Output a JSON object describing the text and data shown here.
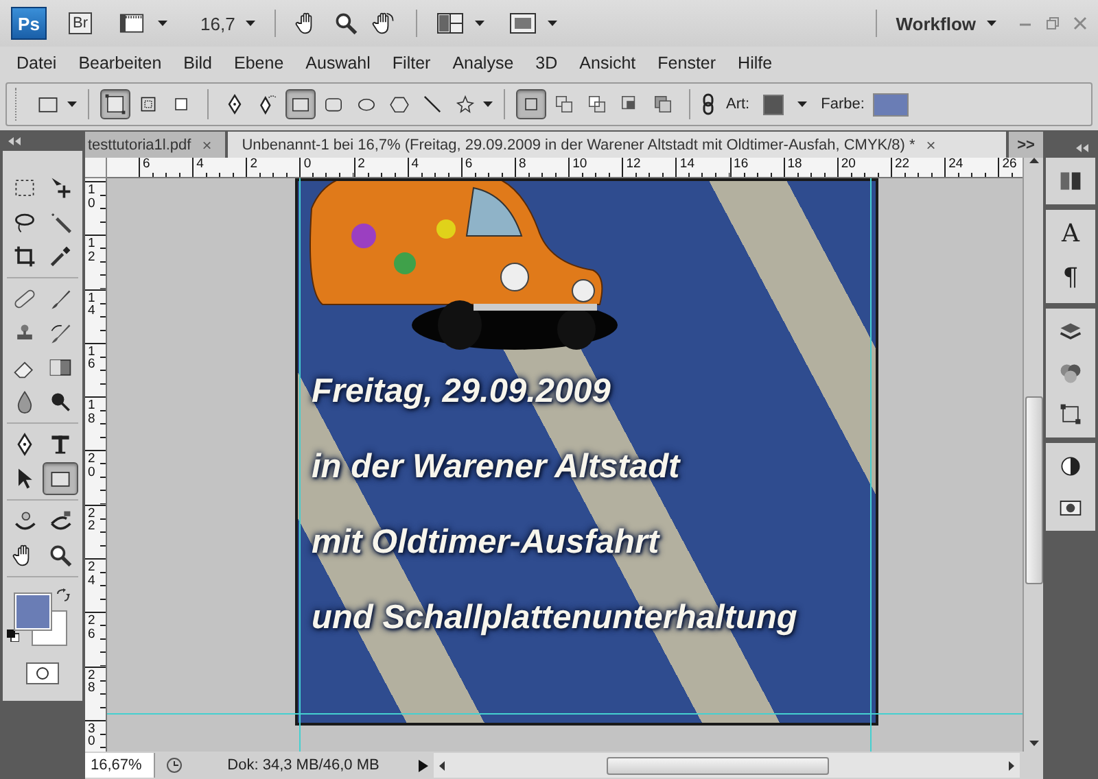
{
  "app_bar": {
    "logo": "Ps",
    "bridge": "Br",
    "zoom": "16,7",
    "workspace": "Workflow"
  },
  "menu": [
    "Datei",
    "Bearbeiten",
    "Bild",
    "Ebene",
    "Auswahl",
    "Filter",
    "Analyse",
    "3D",
    "Ansicht",
    "Fenster",
    "Hilfe"
  ],
  "options_bar": {
    "modes": [
      {
        "kind": "shape-layers",
        "selected": true
      },
      {
        "kind": "paths",
        "selected": false
      },
      {
        "kind": "fill-pixels",
        "selected": false
      }
    ],
    "shapes": [
      {
        "kind": "pen",
        "selected": false
      },
      {
        "kind": "freeform-pen",
        "selected": false
      },
      {
        "kind": "rectangle",
        "selected": true
      },
      {
        "kind": "rounded-rectangle",
        "selected": false
      },
      {
        "kind": "ellipse",
        "selected": false
      },
      {
        "kind": "polygon",
        "selected": false
      },
      {
        "kind": "line",
        "selected": false
      },
      {
        "kind": "custom-shape",
        "selected": false
      }
    ],
    "combine": [
      {
        "kind": "new",
        "selected": true
      },
      {
        "kind": "add",
        "selected": false
      },
      {
        "kind": "subtract",
        "selected": false
      },
      {
        "kind": "intersect",
        "selected": false
      },
      {
        "kind": "exclude",
        "selected": false
      }
    ],
    "style_label": "Art:",
    "color_label": "Farbe:"
  },
  "document_tabs": [
    {
      "title": "testtutoria1l.pdf",
      "close": "×",
      "selected": false
    },
    {
      "title": "Unbenannt-1 bei 16,7% (Freitag, 29.09.2009 in der Warener Altstadt mit Oldtimer-Ausfah, CMYK/8) *",
      "close": "×",
      "selected": true
    }
  ],
  "tabs_overflow": ">>",
  "toolbox": [
    [
      {
        "kind": "marquee",
        "selected": false
      },
      {
        "kind": "move",
        "selected": false
      },
      {
        "kind": "lasso",
        "selected": false
      },
      {
        "kind": "magic-wand",
        "selected": false
      },
      {
        "kind": "crop",
        "selected": false
      },
      {
        "kind": "eyedropper",
        "selected": false
      }
    ],
    [
      {
        "kind": "healing",
        "selected": false
      },
      {
        "kind": "brush",
        "selected": false
      },
      {
        "kind": "stamp",
        "selected": false
      },
      {
        "kind": "history-brush",
        "selected": false
      },
      {
        "kind": "eraser",
        "selected": false
      },
      {
        "kind": "gradient",
        "selected": false
      },
      {
        "kind": "blur",
        "selected": false
      },
      {
        "kind": "burn",
        "selected": false
      }
    ],
    [
      {
        "kind": "pen",
        "selected": false
      },
      {
        "kind": "type",
        "selected": false
      },
      {
        "kind": "path-select",
        "selected": false
      },
      {
        "kind": "rectangle",
        "selected": true
      }
    ],
    [
      {
        "kind": "rotate-3d",
        "selected": false
      },
      {
        "kind": "orbit-3d",
        "selected": false
      },
      {
        "kind": "hand",
        "selected": false
      },
      {
        "kind": "zoom",
        "selected": false
      }
    ]
  ],
  "rulers": {
    "horizontal": [
      "6",
      "4",
      "2",
      "0",
      "2",
      "4",
      "6",
      "8",
      "10",
      "12",
      "14",
      "16",
      "18",
      "20",
      "22",
      "24",
      "26"
    ],
    "vertical": [
      "10",
      "12",
      "14",
      "16",
      "18",
      "20",
      "22",
      "24",
      "26",
      "28",
      "30"
    ]
  },
  "right_panel": {
    "glyphs": [
      "A",
      "¶"
    ]
  },
  "poster": {
    "lines": [
      "Freitag, 29.09.2009",
      "in der Warener Altstadt",
      "mit Oldtimer-Ausfahrt",
      "und Schallplattenunterhaltung"
    ]
  },
  "status_bar": {
    "zoom": "16,67%",
    "doc_info": "Dok: 34,3 MB/46,0 MB"
  }
}
